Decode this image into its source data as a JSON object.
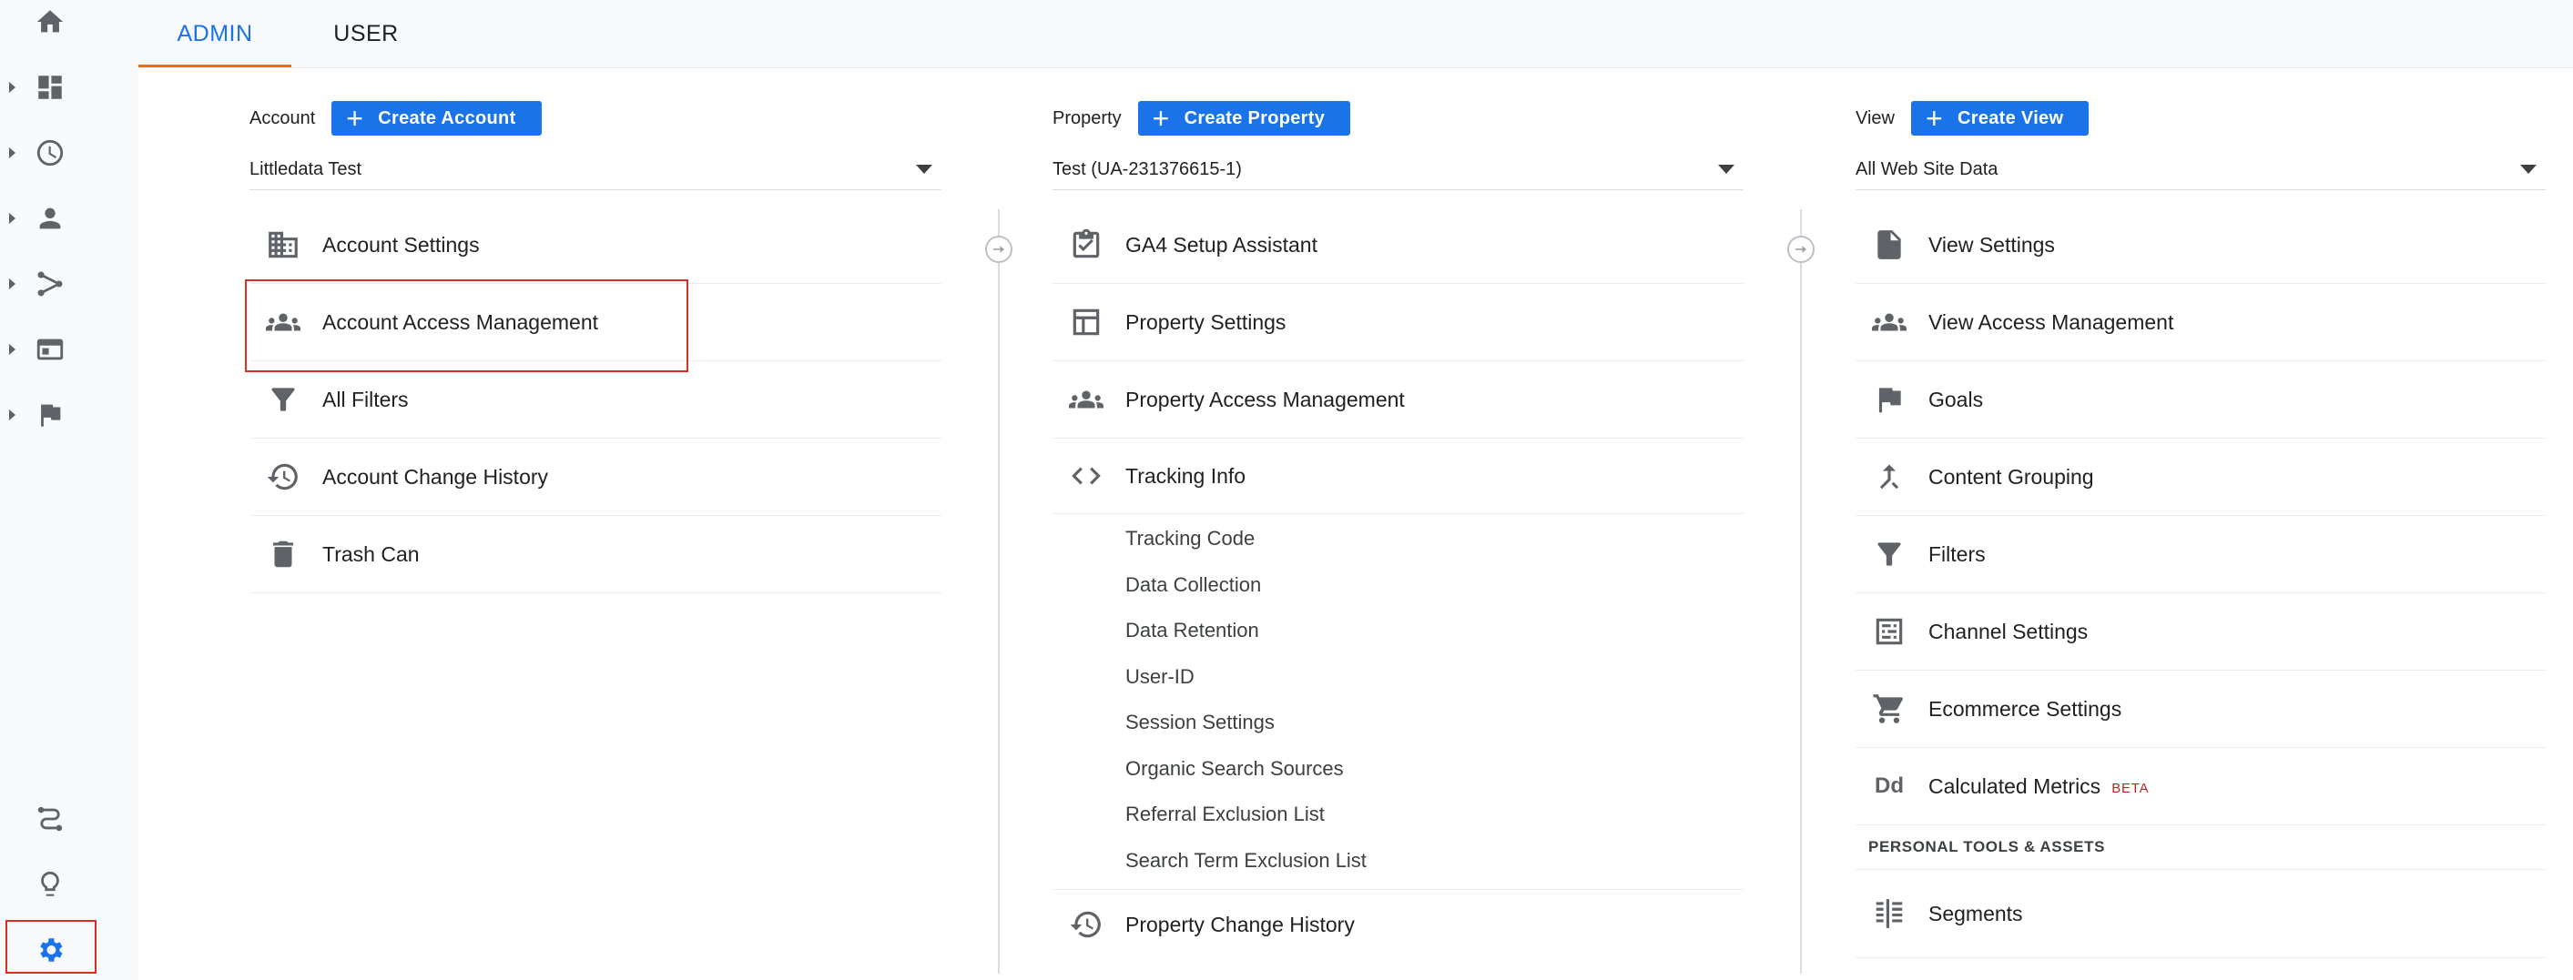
{
  "tabs": [
    {
      "label": "ADMIN"
    },
    {
      "label": "USER"
    }
  ],
  "rail": {
    "items": [
      "home-icon",
      "customization-icon",
      "realtime-icon",
      "audience-icon",
      "acquisition-icon",
      "behavior-icon",
      "conversions-icon",
      "attribution-icon",
      "discover-icon",
      "admin-icon"
    ]
  },
  "account": {
    "label": "Account",
    "create_label": "Create Account",
    "selected": "Littledata Test",
    "items": [
      {
        "label": "Account Settings",
        "icon": "building-icon"
      },
      {
        "label": "Account Access Management",
        "icon": "people-icon"
      },
      {
        "label": "All Filters",
        "icon": "filter-icon"
      },
      {
        "label": "Account Change History",
        "icon": "history-icon"
      },
      {
        "label": "Trash Can",
        "icon": "trash-icon"
      }
    ]
  },
  "property": {
    "label": "Property",
    "create_label": "Create Property",
    "selected": "Test (UA-231376615-1)",
    "items": [
      {
        "label": "GA4 Setup Assistant",
        "icon": "checklist-icon"
      },
      {
        "label": "Property Settings",
        "icon": "layout-icon"
      },
      {
        "label": "Property Access Management",
        "icon": "people-icon"
      },
      {
        "label": "Tracking Info",
        "icon": "code-icon"
      }
    ],
    "tracking_sub": [
      "Tracking Code",
      "Data Collection",
      "Data Retention",
      "User-ID",
      "Session Settings",
      "Organic Search Sources",
      "Referral Exclusion List",
      "Search Term Exclusion List"
    ],
    "change_history": "Property Change History"
  },
  "view": {
    "label": "View",
    "create_label": "Create View",
    "selected": "All Web Site Data",
    "items": [
      {
        "label": "View Settings",
        "icon": "document-icon"
      },
      {
        "label": "View Access Management",
        "icon": "people-icon"
      },
      {
        "label": "Goals",
        "icon": "flag-icon"
      },
      {
        "label": "Content Grouping",
        "icon": "merge-icon"
      },
      {
        "label": "Filters",
        "icon": "filter-icon"
      },
      {
        "label": "Channel Settings",
        "icon": "channel-icon"
      },
      {
        "label": "Ecommerce Settings",
        "icon": "cart-icon"
      },
      {
        "label": "Calculated Metrics",
        "icon": "dd-icon",
        "badge": "BETA"
      }
    ],
    "section_title": "PERSONAL TOOLS & ASSETS",
    "segments": "Segments"
  },
  "colors": {
    "accent": "#1a73e8",
    "highlight": "#d93025",
    "tab_underline": "#e8710a"
  }
}
